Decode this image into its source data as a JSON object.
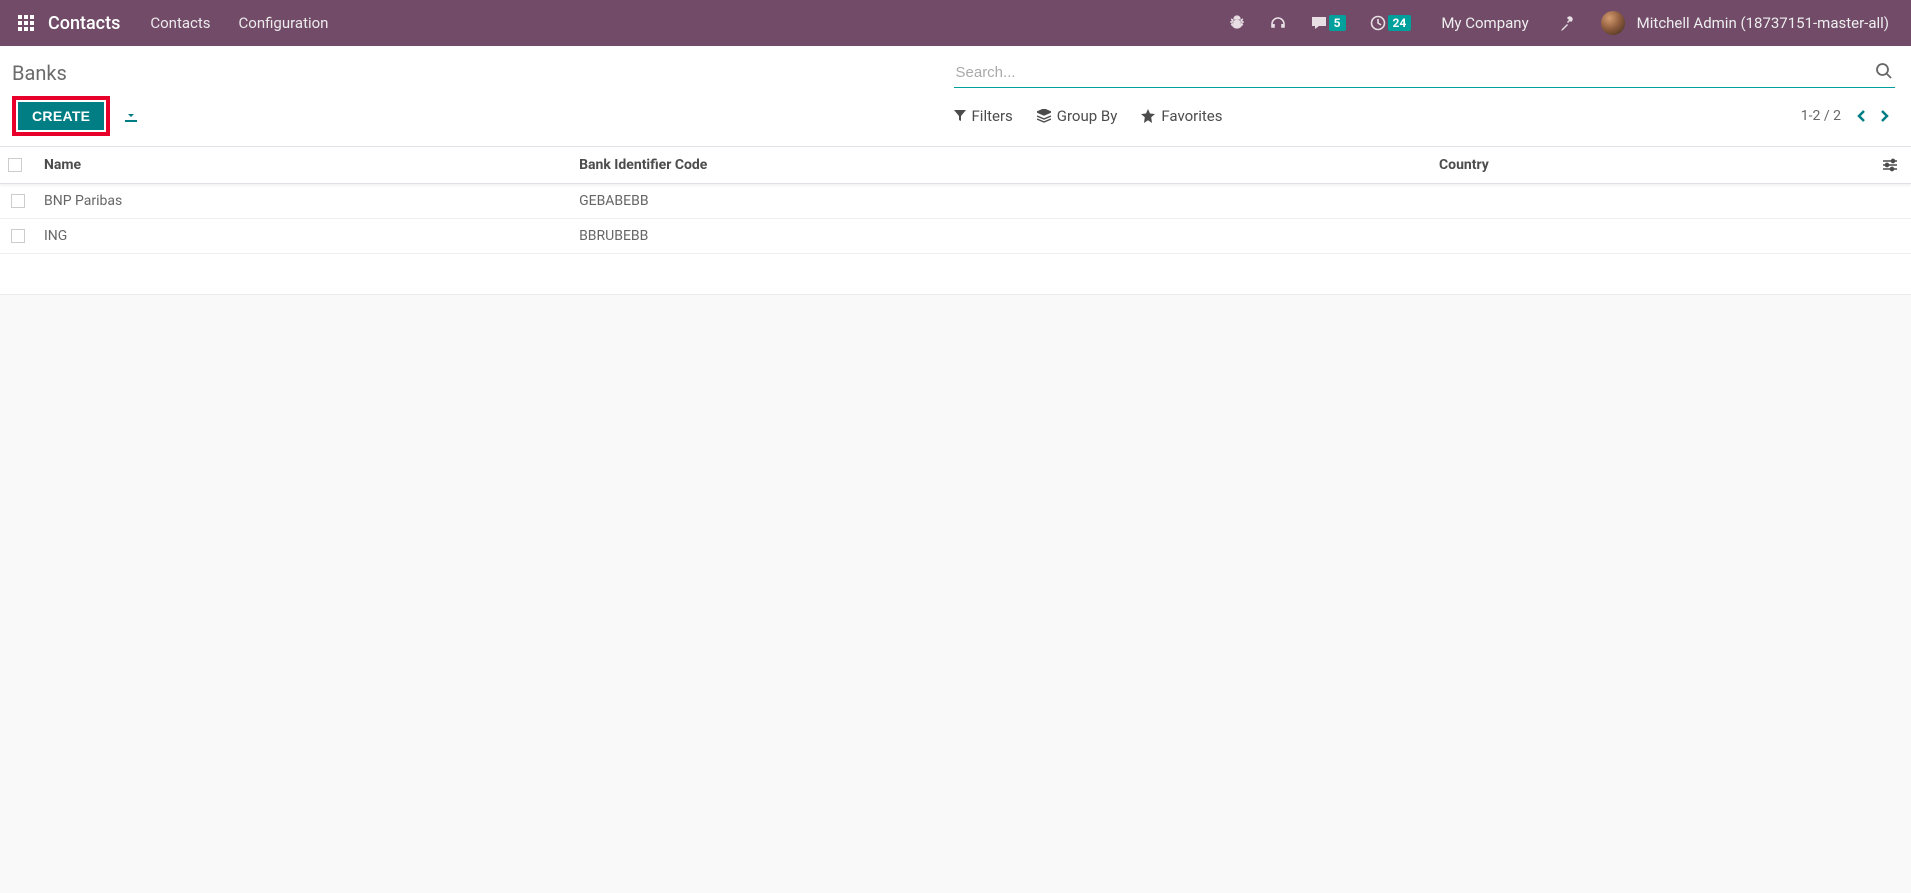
{
  "nav": {
    "brand": "Contacts",
    "menu": [
      "Contacts",
      "Configuration"
    ],
    "company": "My Company",
    "user": "Mitchell Admin (18737151-master-all)",
    "messaging_count": "5",
    "activity_count": "24"
  },
  "control_panel": {
    "title": "Banks",
    "create_label": "CREATE",
    "search_placeholder": "Search...",
    "filters_label": "Filters",
    "groupby_label": "Group By",
    "favorites_label": "Favorites",
    "pager": "1-2 / 2"
  },
  "table": {
    "columns": {
      "name": "Name",
      "bic": "Bank Identifier Code",
      "country": "Country"
    },
    "rows": [
      {
        "name": "BNP Paribas",
        "bic": "GEBABEBB",
        "country": ""
      },
      {
        "name": "ING",
        "bic": "BBRUBEBB",
        "country": ""
      }
    ]
  }
}
